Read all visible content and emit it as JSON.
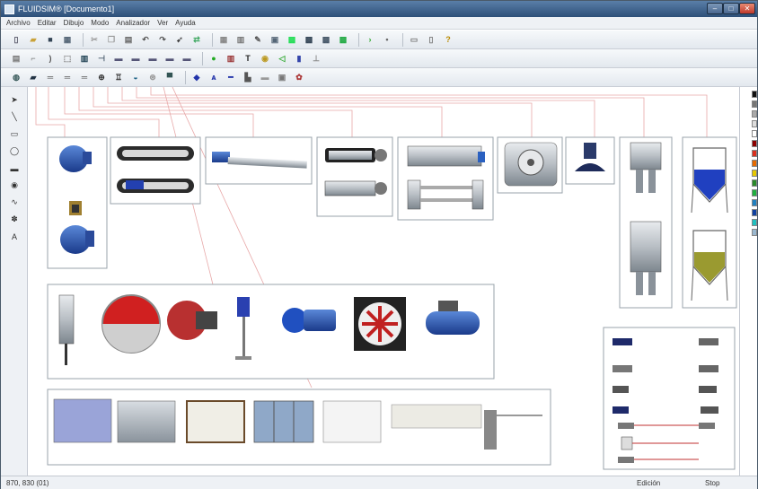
{
  "window": {
    "title": "FLUIDSIM® [Documento1]",
    "controls": {
      "minimize": "–",
      "maximize": "□",
      "close": "✕"
    }
  },
  "menu": [
    {
      "label": "Archivo"
    },
    {
      "label": "Editar"
    },
    {
      "label": "Dibujo"
    },
    {
      "label": "Modo"
    },
    {
      "label": "Analizador"
    },
    {
      "label": "Ver"
    },
    {
      "label": "Ayuda"
    }
  ],
  "toolbar1": [
    {
      "name": "new-icon",
      "glyph": "▯",
      "color": "#556"
    },
    {
      "name": "open-icon",
      "glyph": "▰",
      "color": "#c9a23a"
    },
    {
      "name": "save-icon",
      "glyph": "■",
      "color": "#345"
    },
    {
      "name": "print-preview-icon",
      "glyph": "▦",
      "color": "#567"
    },
    {
      "sep": true
    },
    {
      "name": "cut-icon",
      "glyph": "✂",
      "color": "#999"
    },
    {
      "name": "copy-icon",
      "glyph": "❐",
      "color": "#999"
    },
    {
      "name": "paste-icon",
      "glyph": "▤",
      "color": "#666"
    },
    {
      "name": "undo-icon",
      "glyph": "↶",
      "color": "#555"
    },
    {
      "name": "redo-icon",
      "glyph": "↷",
      "color": "#555"
    },
    {
      "name": "pointer-tool-icon",
      "glyph": "➹",
      "color": "#444"
    },
    {
      "name": "link-icon",
      "glyph": "⇄",
      "color": "#4a6"
    },
    {
      "sep": true
    },
    {
      "name": "grid-icon",
      "glyph": "▦",
      "color": "#888"
    },
    {
      "name": "table-icon",
      "glyph": "▥",
      "color": "#777"
    },
    {
      "name": "pen-icon",
      "glyph": "✎",
      "color": "#555"
    },
    {
      "name": "image-icon",
      "glyph": "▣",
      "color": "#567"
    },
    {
      "name": "library-icon",
      "glyph": "▩",
      "color": "#2d5"
    },
    {
      "name": "component-icon",
      "glyph": "▩",
      "color": "#345"
    },
    {
      "name": "panel-icon",
      "glyph": "▩",
      "color": "#456"
    },
    {
      "name": "dark-panel-icon",
      "glyph": "▩",
      "color": "#2a4"
    },
    {
      "sep": true
    },
    {
      "name": "play-icon",
      "glyph": "›",
      "color": "#3a3"
    },
    {
      "name": "stop-icon",
      "glyph": "•",
      "color": "#666"
    },
    {
      "sep": true
    },
    {
      "name": "zoom-box-icon",
      "glyph": "▭",
      "color": "#777"
    },
    {
      "name": "zoom-fit-icon",
      "glyph": "▯",
      "color": "#777"
    },
    {
      "name": "help-icon",
      "glyph": "?",
      "color": "#b88a00"
    }
  ],
  "toolbar2": [
    {
      "name": "align-icon",
      "glyph": "▤",
      "color": "#777"
    },
    {
      "name": "crop-icon",
      "glyph": "⌐",
      "color": "#777"
    },
    {
      "name": "arc-icon",
      "glyph": ")",
      "color": "#555"
    },
    {
      "name": "select-area-icon",
      "glyph": "⬚",
      "color": "#777"
    },
    {
      "name": "valve-block-icon",
      "glyph": "▥",
      "color": "#245"
    },
    {
      "name": "relay-icon",
      "glyph": "⊣",
      "color": "#456"
    },
    {
      "name": "module-a-icon",
      "glyph": "▬",
      "color": "#557"
    },
    {
      "name": "module-b-icon",
      "glyph": "▬",
      "color": "#557"
    },
    {
      "name": "module-c-icon",
      "glyph": "▬",
      "color": "#557"
    },
    {
      "name": "module-d-icon",
      "glyph": "▬",
      "color": "#557"
    },
    {
      "name": "module-e-icon",
      "glyph": "▬",
      "color": "#557"
    },
    {
      "sep": true
    },
    {
      "name": "lamp-icon",
      "glyph": "●",
      "color": "#2a2"
    },
    {
      "name": "display-icon",
      "glyph": "▥",
      "color": "#933"
    },
    {
      "name": "text-tool-icon",
      "glyph": "T",
      "color": "#222"
    },
    {
      "name": "gauge-icon",
      "glyph": "◉",
      "color": "#b92"
    },
    {
      "name": "sound-icon",
      "glyph": "◁",
      "color": "#3a3"
    },
    {
      "name": "sensor-icon",
      "glyph": "▮",
      "color": "#34a"
    },
    {
      "name": "plug-icon",
      "glyph": "⊥",
      "color": "#888"
    }
  ],
  "toolbar3": [
    {
      "name": "motor-tool-icon",
      "glyph": "◍",
      "color": "#355"
    },
    {
      "name": "conveyor-tool-icon",
      "glyph": "▰",
      "color": "#234"
    },
    {
      "name": "cylinder-a-icon",
      "glyph": "═",
      "color": "#555"
    },
    {
      "name": "cylinder-b-icon",
      "glyph": "═",
      "color": "#555"
    },
    {
      "name": "cylinder-c-icon",
      "glyph": "═",
      "color": "#555"
    },
    {
      "name": "vacuum-tool-icon",
      "glyph": "⊕",
      "color": "#333"
    },
    {
      "name": "gripper-tool-icon",
      "glyph": "♖",
      "color": "#333"
    },
    {
      "name": "cup-tool-icon",
      "glyph": "◒",
      "color": "#268"
    },
    {
      "name": "fan-tool-icon",
      "glyph": "⊛",
      "color": "#999"
    },
    {
      "name": "screen-tool-icon",
      "glyph": "▀",
      "color": "#355"
    },
    {
      "sep": true
    },
    {
      "name": "drop-tool-icon",
      "glyph": "◆",
      "color": "#23a"
    },
    {
      "name": "pump-tool-icon",
      "glyph": "ѧ",
      "color": "#23a"
    },
    {
      "name": "pipe-tool-icon",
      "glyph": "━",
      "color": "#23a"
    },
    {
      "name": "machine-tool-icon",
      "glyph": "▙",
      "color": "#555"
    },
    {
      "name": "line-tool-icon",
      "glyph": "▬",
      "color": "#999"
    },
    {
      "name": "box-tool-icon",
      "glyph": "▣",
      "color": "#777"
    },
    {
      "name": "bee-tool-icon",
      "glyph": "✿",
      "color": "#a33"
    }
  ],
  "tools": [
    {
      "name": "select-arrow-icon",
      "glyph": "➤"
    },
    {
      "name": "line-tool-icon",
      "glyph": "╲"
    },
    {
      "name": "rectangle-tool-icon",
      "glyph": "▭"
    },
    {
      "name": "ellipse-tool-icon",
      "glyph": "◯"
    },
    {
      "name": "rounded-rect-tool-icon",
      "glyph": "▬"
    },
    {
      "name": "fill-tool-icon",
      "glyph": "◉"
    },
    {
      "name": "bezier-tool-icon",
      "glyph": "∿"
    },
    {
      "name": "spray-tool-icon",
      "glyph": "✽"
    },
    {
      "name": "text-a-tool-icon",
      "glyph": "A"
    }
  ],
  "palette": [
    "#111111",
    "#777777",
    "#aaaaaa",
    "#dddddd",
    "#ffffff",
    "#8b0000",
    "#d93020",
    "#e56a00",
    "#e6c800",
    "#2a8a2a",
    "#20b040",
    "#2080c0",
    "#1040a0",
    "#20c0c0",
    "#9ab8d0"
  ],
  "status": {
    "coords": "870, 830 (01)",
    "mode": "Edición",
    "state": "Stop"
  }
}
